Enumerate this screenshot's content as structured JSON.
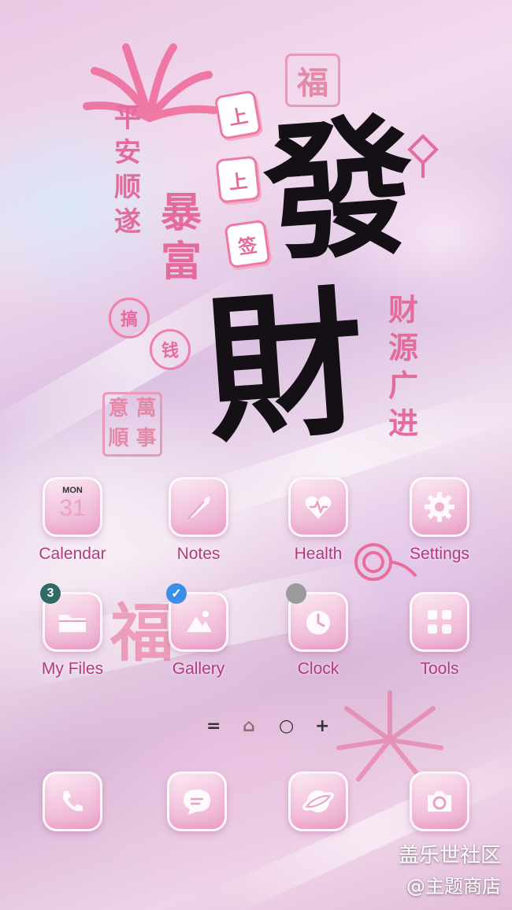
{
  "wallpaper": {
    "main_chars": [
      "發",
      "財"
    ],
    "tiles": [
      "上",
      "上",
      "签"
    ],
    "left_vertical": [
      "平",
      "安",
      "顺",
      "遂"
    ],
    "center_vertical": [
      "暴",
      "富"
    ],
    "right_vertical": [
      "财",
      "源",
      "广",
      "进"
    ],
    "round_badges": [
      "搞",
      "钱"
    ],
    "seal_top": "福",
    "seal_bottom": [
      "萬",
      "事",
      "順",
      "意"
    ],
    "fu_char": "福",
    "colors": {
      "ink": "#151015",
      "accent": "#e46c9c"
    }
  },
  "apps": [
    {
      "label": "Calendar",
      "icon": "calendar-icon",
      "month": "MON",
      "day": "31"
    },
    {
      "label": "Notes",
      "icon": "feather-icon"
    },
    {
      "label": "Health",
      "icon": "heart-icon"
    },
    {
      "label": "Settings",
      "icon": "gear-icon"
    },
    {
      "label": "My Files",
      "icon": "folder-icon",
      "badge": "3",
      "badge_color": "#2e6b67"
    },
    {
      "label": "Gallery",
      "icon": "image-icon",
      "badge": "✓",
      "badge_color": "#3a8ee6"
    },
    {
      "label": "Clock",
      "icon": "clock-icon",
      "badge_color": "#9a9a9a"
    },
    {
      "label": "Tools",
      "icon": "grid-icon"
    }
  ],
  "page_indicator": [
    "=",
    "⌂",
    "○",
    "+"
  ],
  "dock": [
    {
      "icon": "phone-icon"
    },
    {
      "icon": "message-icon"
    },
    {
      "icon": "browser-icon"
    },
    {
      "icon": "camera-icon"
    }
  ],
  "watermark": {
    "line1": "盖乐世社区",
    "line2": "@主题商店"
  }
}
